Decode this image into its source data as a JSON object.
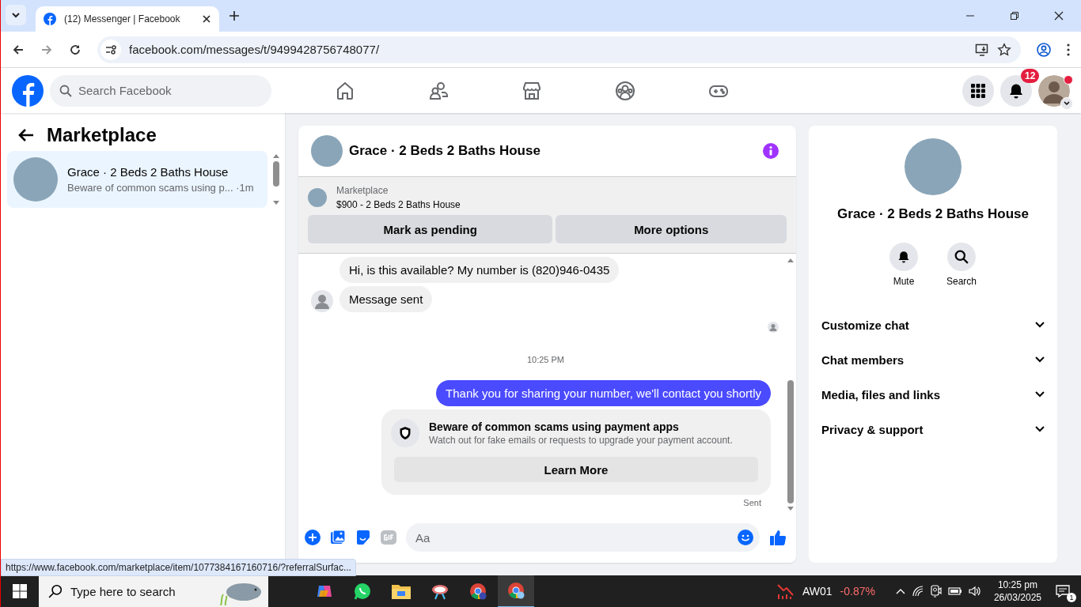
{
  "browser": {
    "tabs": [
      {
        "title": "(12) Messenger | Facebook",
        "selected": true
      }
    ],
    "url": "facebook.com/messages/t/9499428756748077/"
  },
  "header": {
    "search": {
      "placeholder": "Search Facebook"
    },
    "nav": [
      {
        "kind": "home",
        "selected": false
      },
      {
        "kind": "friends",
        "selected": false
      },
      {
        "kind": "marketplace",
        "selected": false
      },
      {
        "kind": "groups",
        "selected": false
      },
      {
        "kind": "gaming",
        "selected": false
      }
    ],
    "notification_count": "12"
  },
  "sidebar": {
    "title": "Marketplace",
    "conversations": [
      {
        "title": "Grace · 2 Beds 2 Baths House",
        "preview": "Beware of common scams using p...",
        "time": "·1m",
        "selected": true
      }
    ]
  },
  "chat": {
    "title": "Grace · 2 Beds 2 Baths House",
    "listing": {
      "label": "Marketplace",
      "title": "$900 - 2 Beds 2 Baths House"
    },
    "buttons": [
      "Mark as pending",
      "More options"
    ],
    "messages": [
      {
        "kind": "incoming",
        "text": "Hi, is this available? My number is (820)946-0435",
        "avatar": false
      },
      {
        "kind": "incoming",
        "text": "Message sent",
        "avatar": true
      },
      {
        "kind": "read_receipt"
      },
      {
        "kind": "timestamp",
        "text": "10:25 PM"
      },
      {
        "kind": "outgoing",
        "text": "Thank you for sharing your number, we'll contact you shortly"
      },
      {
        "kind": "notice",
        "title": "Beware of common scams using payment apps",
        "body": "Watch out for fake emails or requests to upgrade your payment account.",
        "button": "Learn More"
      }
    ],
    "status": "Sent",
    "composer": {
      "placeholder": "Aa"
    }
  },
  "info_panel": {
    "name": "Grace · 2 Beds 2 Baths House",
    "actions": [
      {
        "kind": "mute",
        "label": "Mute"
      },
      {
        "kind": "search",
        "label": "Search"
      }
    ],
    "sections": [
      {
        "label": "Customize chat",
        "expanded": false
      },
      {
        "label": "Chat members",
        "expanded": false
      },
      {
        "label": "Media, files and links",
        "expanded": false
      },
      {
        "label": "Privacy & support",
        "expanded": false
      }
    ]
  },
  "link_preview": "https://www.facebook.com/marketplace/item/1077384167160716/?referralSurfac...",
  "taskbar": {
    "search": {
      "placeholder": "Type here to search"
    },
    "ticker": {
      "symbol": "AW01",
      "change": "-0.87%"
    },
    "time": "10:25 pm",
    "date": "26/03/2025",
    "notification_count": "1"
  }
}
